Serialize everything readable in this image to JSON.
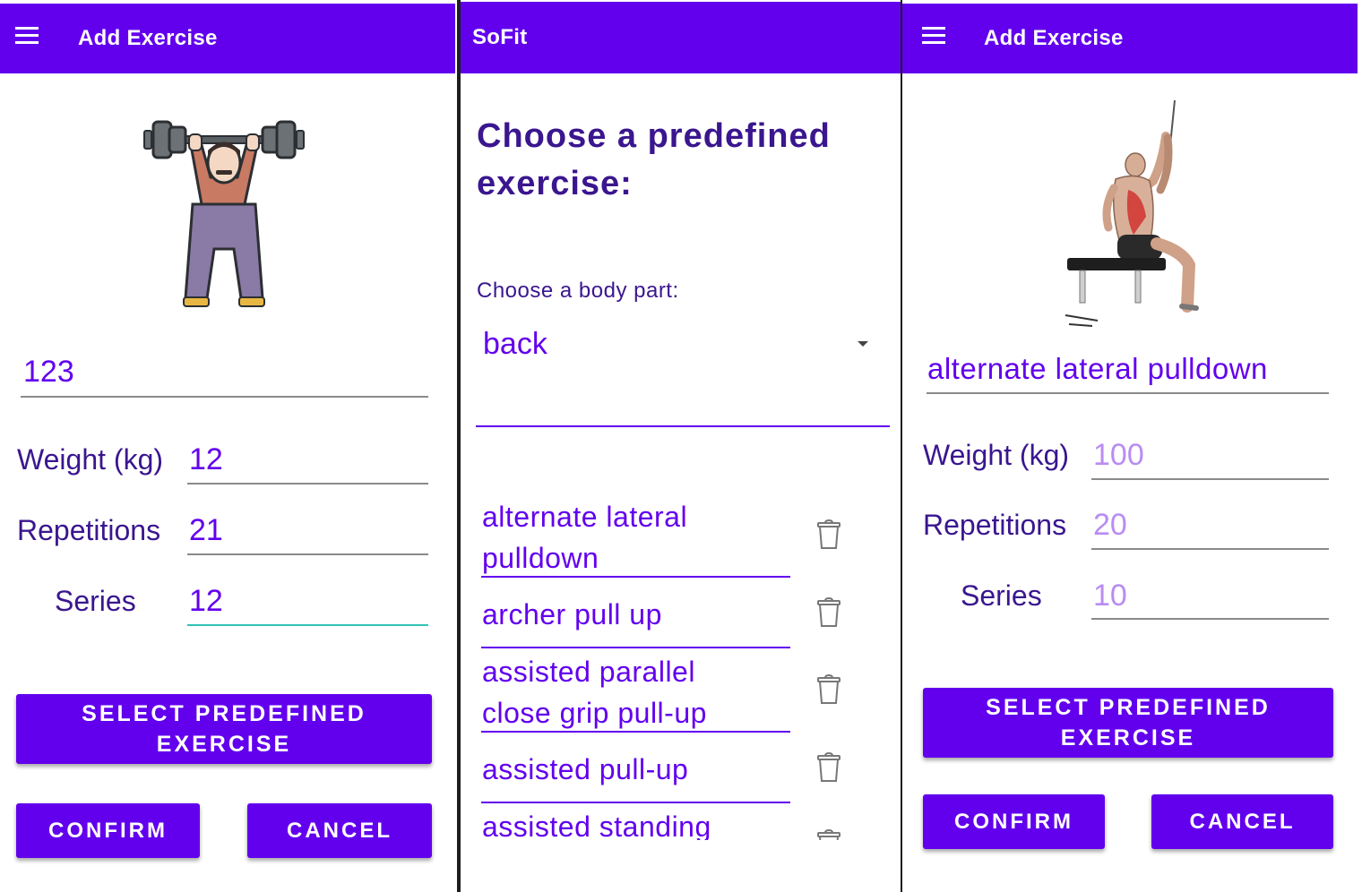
{
  "left_panel": {
    "header": {
      "title": "Add Exercise",
      "menu_icon": "hamburger-menu-icon"
    },
    "illustration": "weightlifter-icon",
    "exercise_name_value": "123",
    "weight": {
      "label": "Weight (kg)",
      "value": "12"
    },
    "repetitions": {
      "label": "Repetitions",
      "value": "21"
    },
    "series": {
      "label": "Series",
      "value": "12"
    },
    "select_button": {
      "line1": "SELECT PREDEFINED",
      "line2": "EXERCISE"
    },
    "confirm_label": "CONFIRM",
    "cancel_label": "CANCEL"
  },
  "middle_panel": {
    "header": {
      "title": "SoFit"
    },
    "heading": {
      "line1": "Choose a predefined",
      "line2": "exercise:"
    },
    "body_part_label": "Choose a body part:",
    "body_part_value": "back",
    "exercises": [
      {
        "line1": "alternate lateral",
        "line2": "pulldown"
      },
      {
        "line1": "archer pull up",
        "line2": ""
      },
      {
        "line1": "assisted parallel",
        "line2": "close grip pull-up"
      },
      {
        "line1": "assisted pull-up",
        "line2": ""
      },
      {
        "line1": "assisted standing",
        "line2": ""
      }
    ]
  },
  "right_panel": {
    "header": {
      "title": "Add Exercise",
      "menu_icon": "hamburger-menu-icon"
    },
    "illustration": "lat-pulldown-exercise-image",
    "exercise_name_value": "alternate lateral pulldown",
    "weight": {
      "label": "Weight (kg)",
      "placeholder": "100"
    },
    "repetitions": {
      "label": "Repetitions",
      "placeholder": "20"
    },
    "series": {
      "label": "Series",
      "placeholder": "10"
    },
    "select_button": {
      "line1": "SELECT PREDEFINED",
      "line2": "EXERCISE"
    },
    "confirm_label": "CONFIRM",
    "cancel_label": "CANCEL"
  },
  "colors": {
    "primary": "#6200ee",
    "label": "#3a168f",
    "hint": "#b98cf2",
    "focus": "#2ec4b6"
  }
}
